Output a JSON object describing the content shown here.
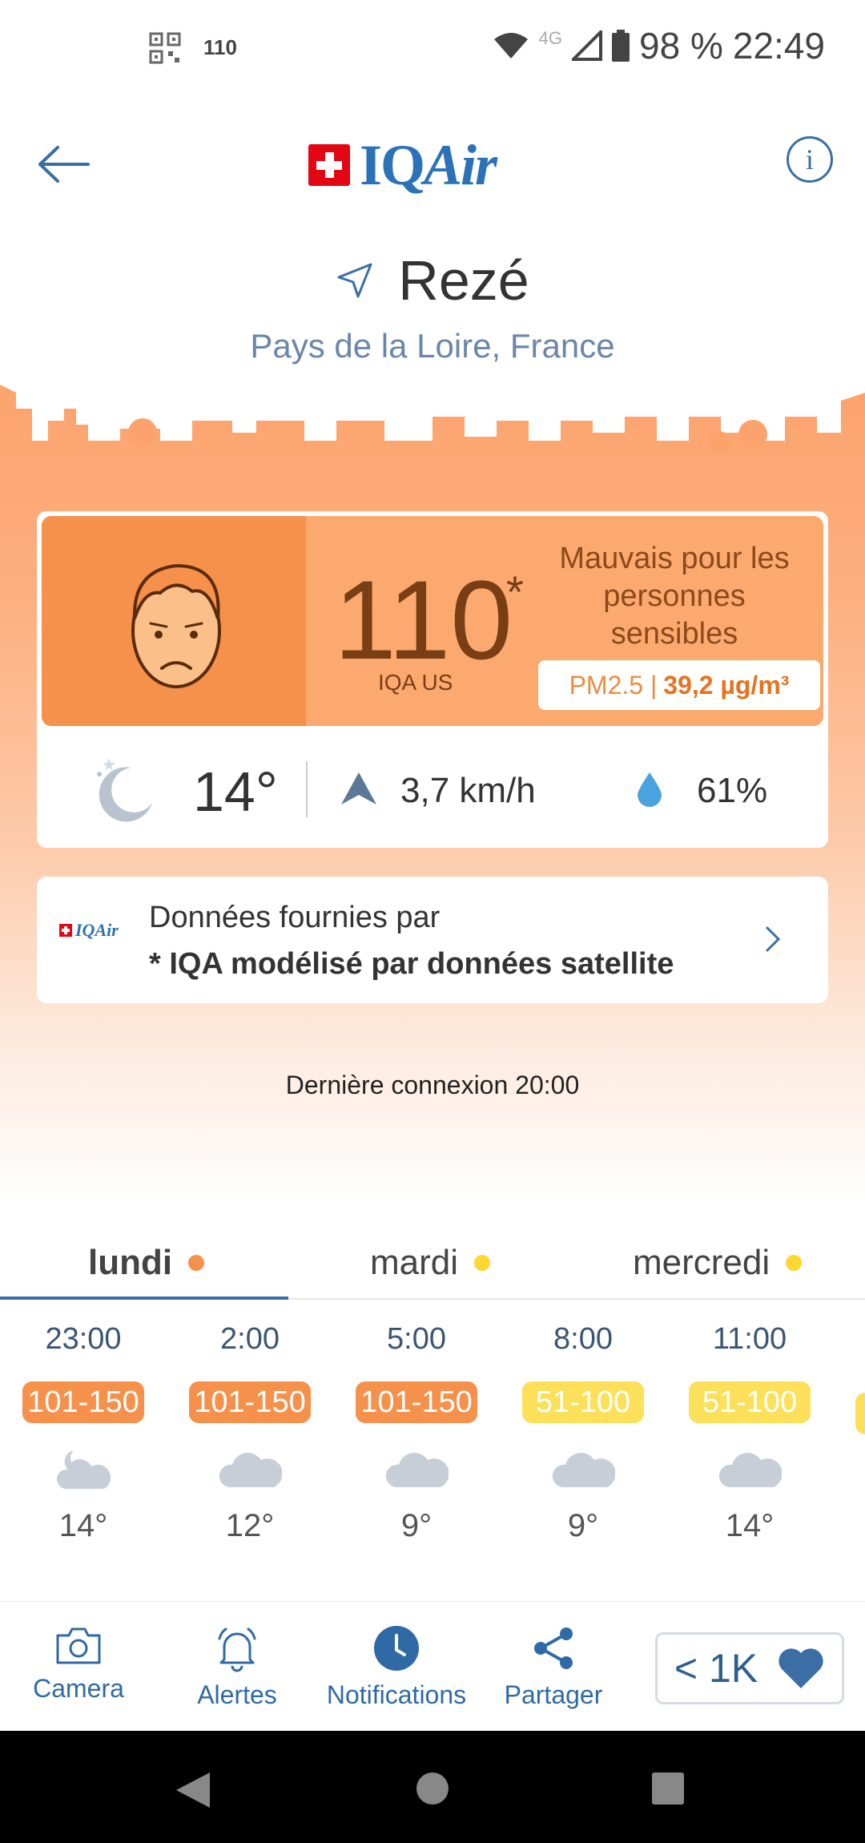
{
  "status_bar": {
    "aqi_notification": "110",
    "network": "4G",
    "battery": "98 %",
    "time": "22:49"
  },
  "header": {
    "logo_text_1": "IQ",
    "logo_text_2": "Air",
    "info_label": "i"
  },
  "location": {
    "city": "Rezé",
    "region": "Pays de la Loire, France"
  },
  "aqi": {
    "value": "110",
    "asterisk": "*",
    "label": "IQA US",
    "status": "Mauvais pour les personnes sensibles",
    "pollutant": "PM2.5 |",
    "concentration": "39,2 µg/m³",
    "color": "#f6914b"
  },
  "weather": {
    "temperature": "14°",
    "wind": "3,7 km/h",
    "humidity": "61%"
  },
  "source": {
    "logo": "IQAir",
    "line1": "Données fournies par",
    "line2": "* IQA modélisé par données satellite"
  },
  "last_connection": "Dernière connexion 20:00",
  "tabs": [
    {
      "label": "lundi",
      "dot": "#f6914b"
    },
    {
      "label": "mardi",
      "dot": "#fdd835"
    },
    {
      "label": "mercredi",
      "dot": "#fdd835"
    }
  ],
  "forecast": [
    {
      "time": "23:00",
      "range": "101-150",
      "color": "#f6914b",
      "icon": "moon-cloud-icon",
      "temp": "14°"
    },
    {
      "time": "2:00",
      "range": "101-150",
      "color": "#f6914b",
      "icon": "cloud-icon",
      "temp": "12°"
    },
    {
      "time": "5:00",
      "range": "101-150",
      "color": "#f6914b",
      "icon": "cloud-icon",
      "temp": "9°"
    },
    {
      "time": "8:00",
      "range": "51-100",
      "color": "#fde05a",
      "icon": "cloud-icon",
      "temp": "9°"
    },
    {
      "time": "11:00",
      "range": "51-100",
      "color": "#fde05a",
      "icon": "cloud-icon",
      "temp": "14°"
    }
  ],
  "toolbar": {
    "camera": "Camera",
    "alerts": "Alertes",
    "notifications": "Notifications",
    "share": "Partager",
    "likes": "< 1K"
  }
}
